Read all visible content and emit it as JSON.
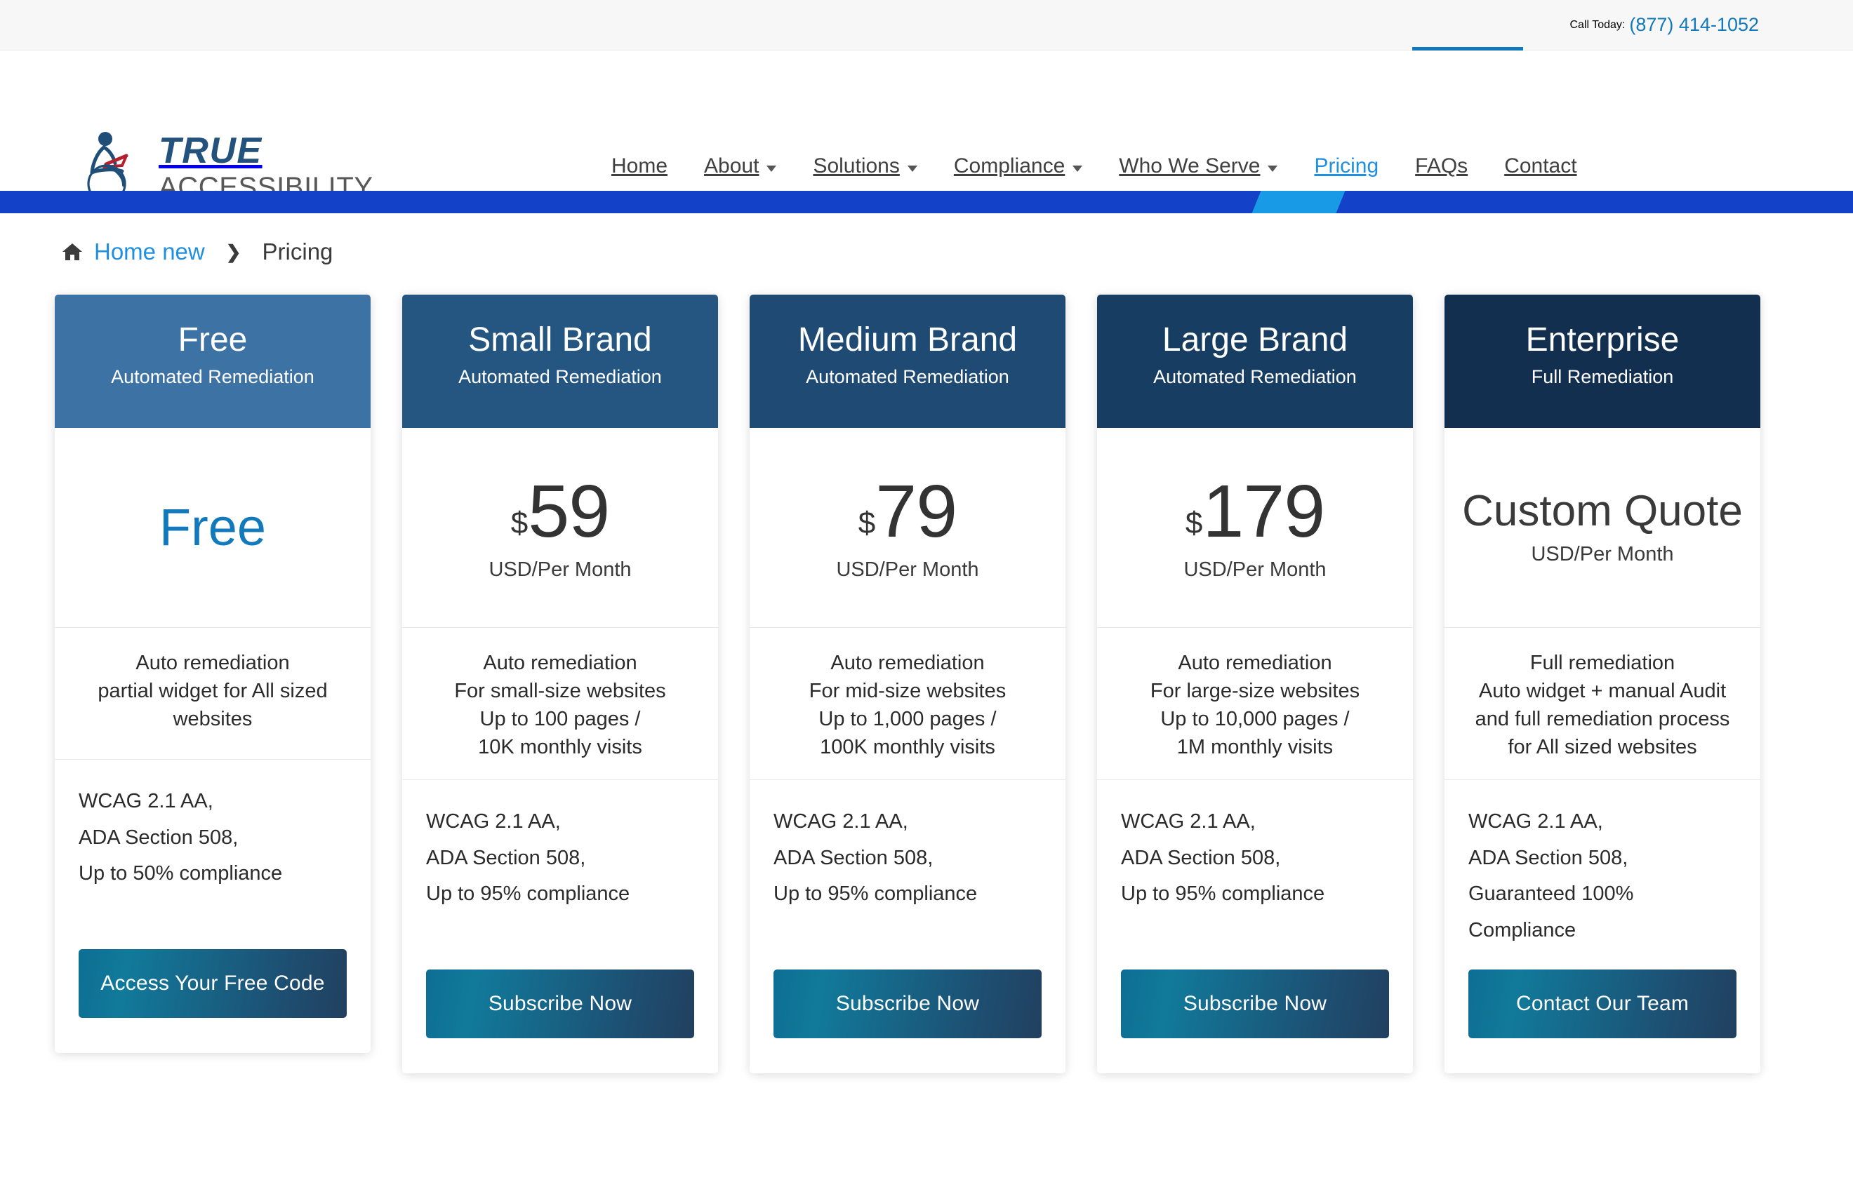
{
  "topbar": {
    "call_label": "Call Today:",
    "phone": "(877) 414-1052"
  },
  "brand": {
    "line1": "TRUE",
    "line2": "ACCESSIBILITY",
    "logo_icon": "wheelchair-user-icon"
  },
  "nav": {
    "items": [
      {
        "label": "Home",
        "has_caret": false,
        "active": false
      },
      {
        "label": "About",
        "has_caret": true,
        "active": false
      },
      {
        "label": "Solutions",
        "has_caret": true,
        "active": false
      },
      {
        "label": "Compliance",
        "has_caret": true,
        "active": false
      },
      {
        "label": "Who We Serve",
        "has_caret": true,
        "active": false
      },
      {
        "label": "Pricing",
        "has_caret": false,
        "active": true
      },
      {
        "label": "FAQs",
        "has_caret": false,
        "active": false
      },
      {
        "label": "Contact",
        "has_caret": false,
        "active": false
      }
    ]
  },
  "breadcrumb": {
    "home_label": "Home new",
    "separator": "❯",
    "current": "Pricing"
  },
  "colors": {
    "accent_blue": "#1279bd",
    "nav_active": "#1f8fe0",
    "stripe": "#1341c8",
    "stripe_accent": "#189ae6",
    "header_free": "#3d72a4",
    "header_small": "#255681",
    "header_medium": "#1e4a73",
    "header_large": "#173e62",
    "header_enterprise": "#132f4f",
    "cta_gradient_from": "#0d6e93",
    "cta_gradient_to": "#22405f"
  },
  "plans": [
    {
      "title": "Free",
      "subtitle": "Automated Remediation",
      "head_color": "#3d72a4",
      "price_type": "free",
      "currency": "",
      "amount": "Free",
      "unit": "",
      "description": "Auto remediation\npartial widget for All sized websites",
      "spec": "WCAG 2.1 AA,\nADA Section 508,\nUp to 50% compliance",
      "cta_label": "Access Your Free Code"
    },
    {
      "title": "Small Brand",
      "subtitle": "Automated Remediation",
      "head_color": "#255681",
      "price_type": "amount",
      "currency": "$",
      "amount": "59",
      "unit": "USD/Per Month",
      "description": "Auto remediation\nFor small-size websites\nUp to 100 pages /\n10K monthly visits",
      "spec": "WCAG 2.1 AA,\nADA Section 508,\nUp to 95% compliance",
      "cta_label": "Subscribe Now"
    },
    {
      "title": "Medium Brand",
      "subtitle": "Automated Remediation",
      "head_color": "#1e4a73",
      "price_type": "amount",
      "currency": "$",
      "amount": "79",
      "unit": "USD/Per Month",
      "description": "Auto remediation\nFor mid-size websites\nUp to 1,000 pages /\n100K monthly visits",
      "spec": "WCAG 2.1 AA,\nADA Section 508,\nUp to 95% compliance",
      "cta_label": "Subscribe Now"
    },
    {
      "title": "Large Brand",
      "subtitle": "Automated Remediation",
      "head_color": "#173e62",
      "price_type": "amount",
      "currency": "$",
      "amount": "179",
      "unit": "USD/Per Month",
      "description": "Auto remediation\nFor large-size websites\nUp to 10,000 pages /\n1M monthly visits",
      "spec": "WCAG 2.1 AA,\nADA Section 508,\nUp to 95% compliance",
      "cta_label": "Subscribe Now"
    },
    {
      "title": "Enterprise",
      "subtitle": "Full Remediation",
      "head_color": "#132f4f",
      "price_type": "custom",
      "currency": "",
      "amount": "Custom Quote",
      "unit": "USD/Per Month",
      "description": "Full remediation\nAuto widget + manual Audit\nand full remediation process\nfor All sized websites",
      "spec": "WCAG 2.1 AA,\nADA Section 508,\nGuaranteed 100%\nCompliance",
      "cta_label": "Contact Our Team"
    }
  ]
}
